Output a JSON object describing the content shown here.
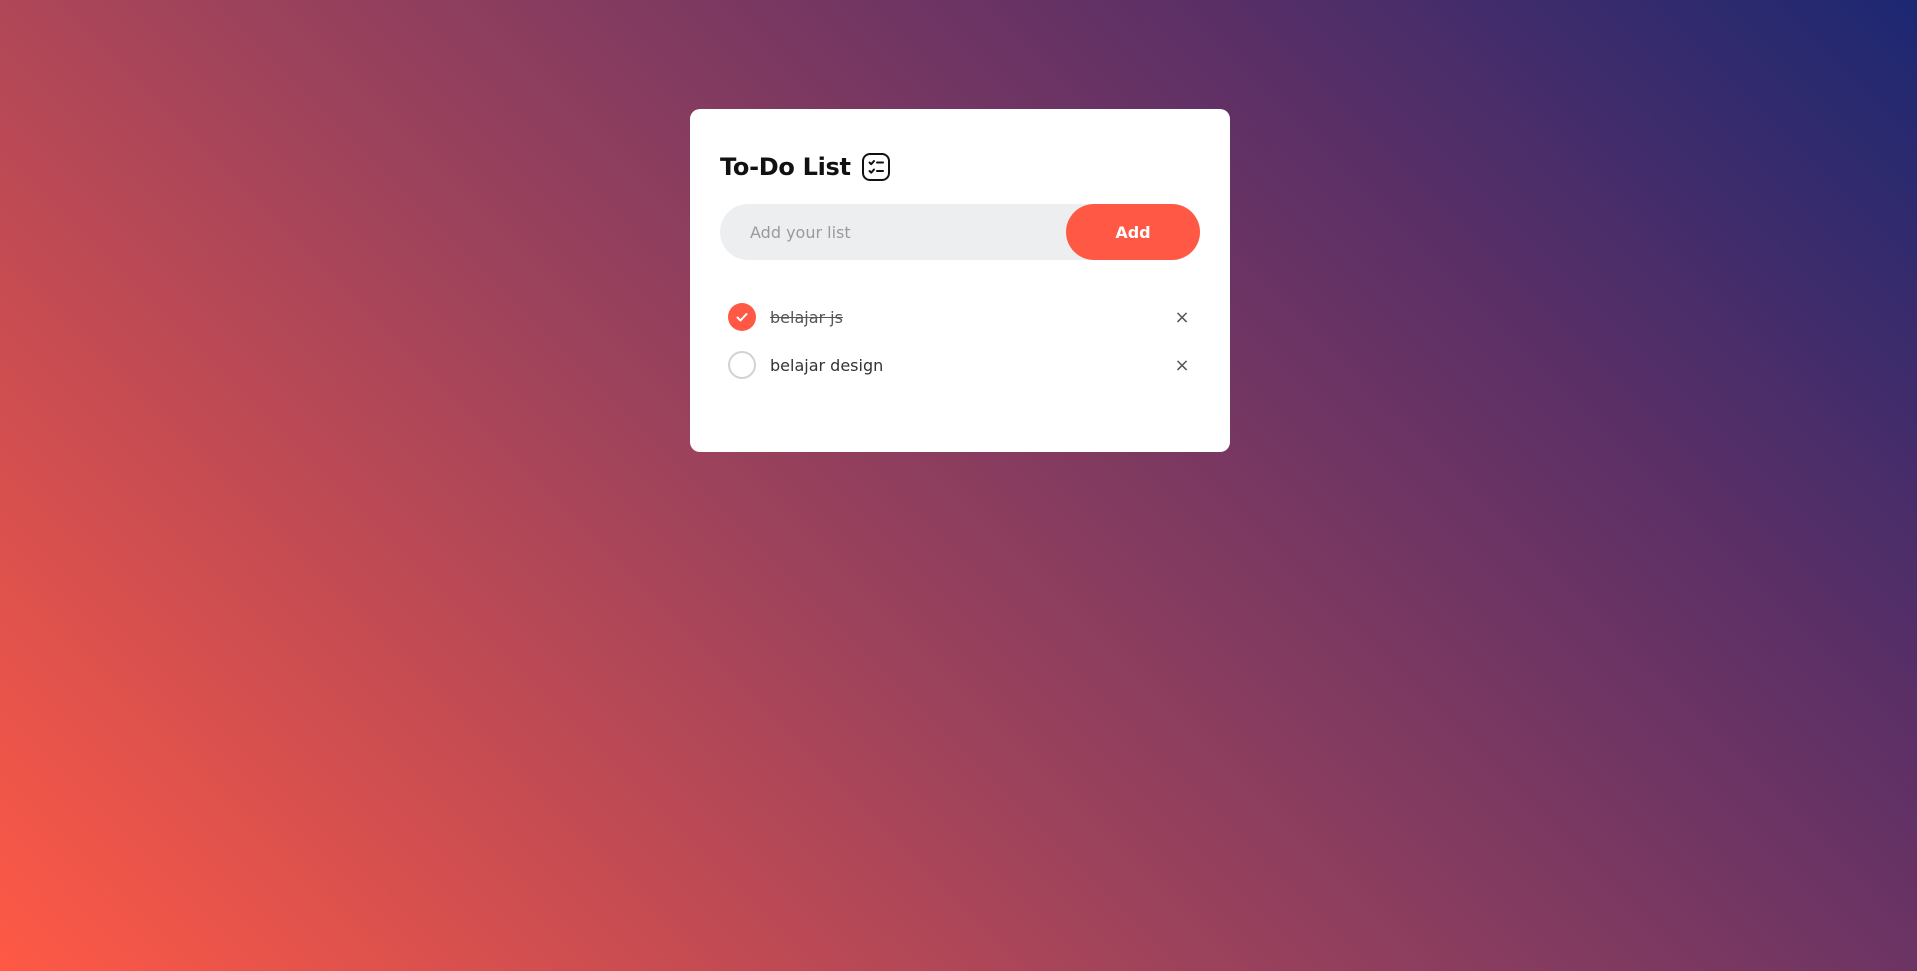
{
  "app": {
    "title": "To-Do List",
    "title_icon": "checklist-icon"
  },
  "input": {
    "value": "",
    "placeholder": "Add your list"
  },
  "add_button": {
    "label": "Add"
  },
  "tasks": [
    {
      "text": "belajar js",
      "done": true,
      "remove_label": "×"
    },
    {
      "text": "belajar design",
      "done": false,
      "remove_label": "×"
    }
  ],
  "colors": {
    "accent": "#ff5945",
    "card": "#ffffff",
    "input_bg": "#edeef0",
    "gradient_start": "#ff5945",
    "gradient_end": "#1c2872"
  }
}
